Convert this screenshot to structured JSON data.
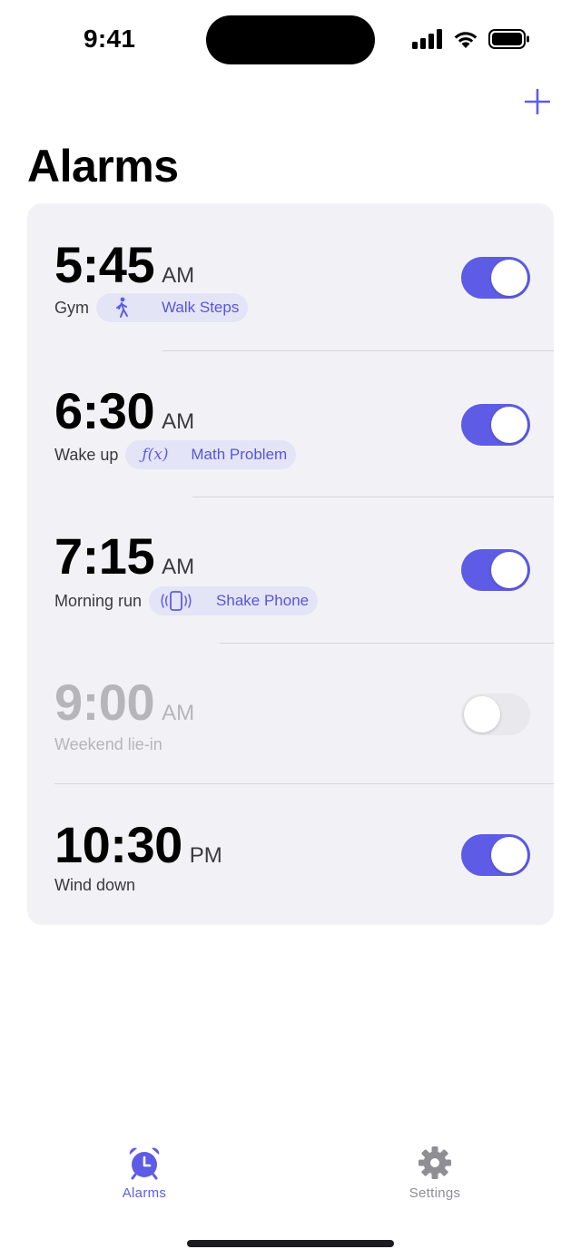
{
  "status_bar": {
    "time": "9:41"
  },
  "header": {
    "title": "Alarms",
    "add_icon": "plus-icon"
  },
  "accent_color": "#5e5ce6",
  "alarms": [
    {
      "time": "5:45",
      "period": "AM",
      "label": "Gym",
      "challenge": {
        "icon": "walking-figure-icon",
        "text": "Walk Steps"
      },
      "enabled": true
    },
    {
      "time": "6:30",
      "period": "AM",
      "label": "Wake up",
      "challenge": {
        "icon": "function-icon",
        "icon_text": "ƒ(x)",
        "text": "Math Problem"
      },
      "enabled": true
    },
    {
      "time": "7:15",
      "period": "AM",
      "label": "Morning run",
      "challenge": {
        "icon": "shaking-phone-icon",
        "text": "Shake Phone"
      },
      "enabled": true
    },
    {
      "time": "9:00",
      "period": "AM",
      "label": "Weekend lie-in",
      "enabled": false
    },
    {
      "time": "10:30",
      "period": "PM",
      "label": "Wind down",
      "enabled": true
    }
  ],
  "tabs": [
    {
      "label": "Alarms",
      "icon": "alarm-clock-icon",
      "selected": true
    },
    {
      "label": "Settings",
      "icon": "gear-icon",
      "selected": false
    }
  ]
}
